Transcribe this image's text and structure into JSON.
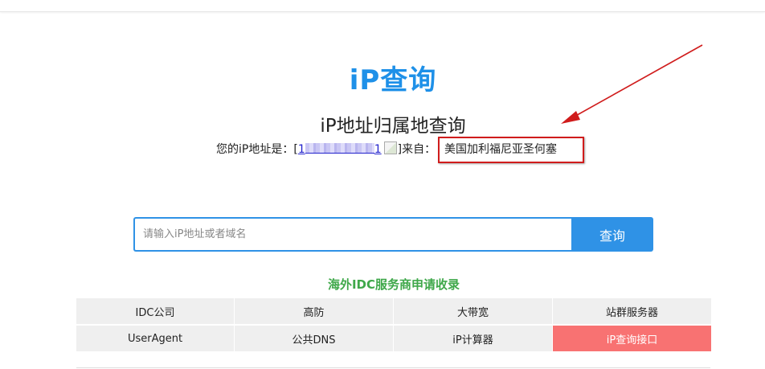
{
  "logo": {
    "text": "iP查询"
  },
  "subtitle": "iP地址归属地查询",
  "ip_info": {
    "prefix_label": "您的iP地址是：",
    "bracket_open": "[",
    "ip_start": "1",
    "ip_end": "1",
    "bracket_close": "]",
    "from_label": "来自：",
    "location": "美国加利福尼亚圣何塞"
  },
  "search": {
    "placeholder": "请输入iP地址或者域名",
    "value": "",
    "button_label": "查询"
  },
  "section_title": "海外IDC服务商申请收录",
  "links": [
    {
      "label": "IDC公司"
    },
    {
      "label": "高防"
    },
    {
      "label": "大带宽"
    },
    {
      "label": "站群服务器"
    },
    {
      "label": "UserAgent"
    },
    {
      "label": "公共DNS"
    },
    {
      "label": "iP计算器"
    },
    {
      "label": "iP查询接口"
    }
  ],
  "colors": {
    "brand_blue": "#1e90e8",
    "button_blue": "#2f92e6",
    "section_green": "#3fa84a",
    "annotation_red": "#d01c1c",
    "highlight_cell": "#f87272"
  }
}
